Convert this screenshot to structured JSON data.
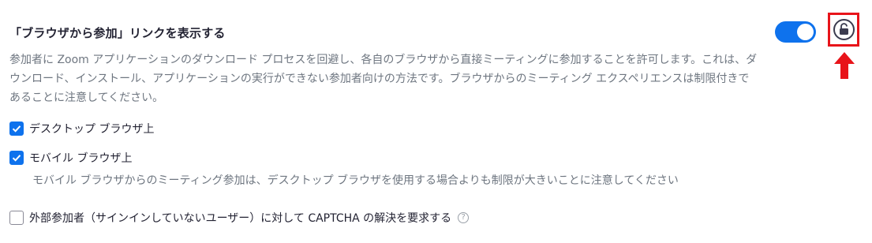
{
  "setting": {
    "title": "「ブラウザから参加」リンクを表示する",
    "enabled": true,
    "description": "参加者に Zoom アプリケーションのダウンロード プロセスを回避し、各自のブラウザから直接ミーティングに参加することを許可します。これは、ダウンロード、インストール、アプリケーションの実行ができない参加者向けの方法です。ブラウザからのミーティング エクスペリエンスは制限付きであることに注意してください。"
  },
  "options": [
    {
      "label": "デスクトップ ブラウザ上",
      "checked": true
    },
    {
      "label": "モバイル ブラウザ上",
      "checked": true,
      "description": "モバイル ブラウザからのミーティング参加は、デスクトップ ブラウザを使用する場合よりも制限が大きいことに注意してください"
    },
    {
      "label": "外部参加者（サインインしていないユーザー）に対して CAPTCHA の解決を要求する",
      "checked": false
    }
  ],
  "help_icon_glyph": "?",
  "colors": {
    "accent": "#0e72ed",
    "highlight": "#e8141a",
    "title": "#232333",
    "muted": "#6e7680"
  },
  "icons": {
    "lock": "unlock-icon",
    "arrow": "arrow-up-icon",
    "help": "help-icon",
    "check": "check-icon"
  }
}
